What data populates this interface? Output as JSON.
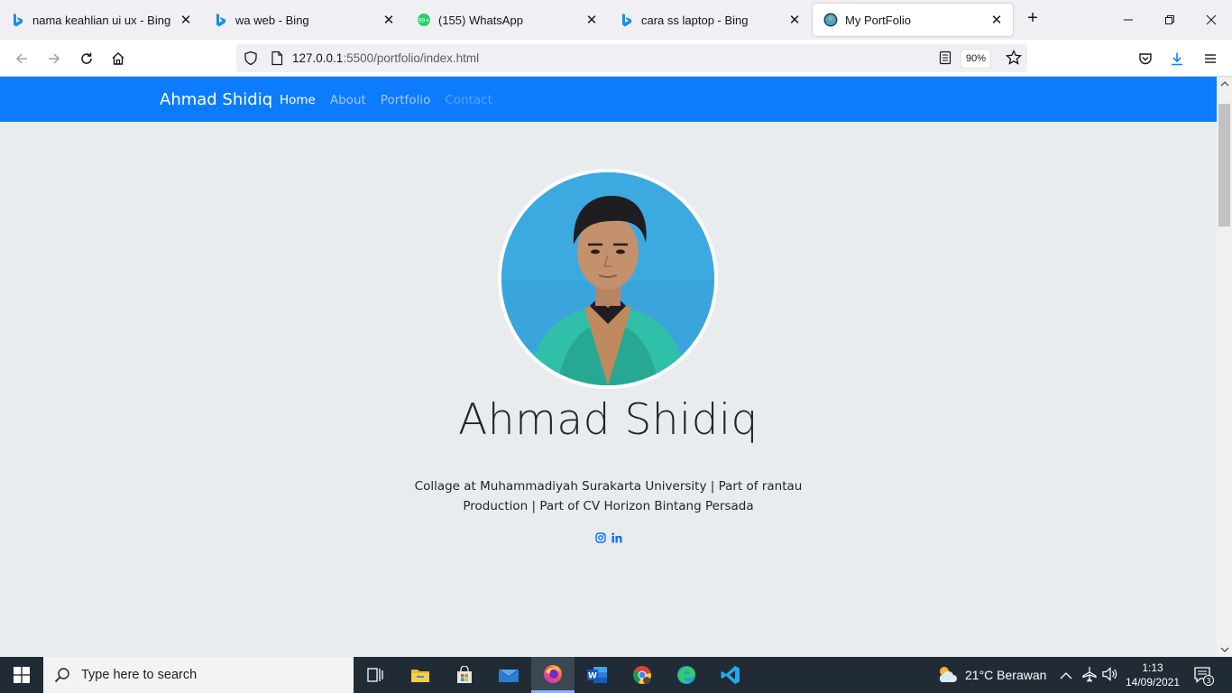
{
  "browser": {
    "tabs": [
      {
        "title": "nama keahlian ui ux - Bing",
        "icon": "bing-icon"
      },
      {
        "title": "wa web - Bing",
        "icon": "bing-icon"
      },
      {
        "title": "(155) WhatsApp",
        "icon": "whatsapp-icon",
        "badge": "99+"
      },
      {
        "title": "cara ss laptop - Bing",
        "icon": "bing-icon"
      },
      {
        "title": "My PortFolio",
        "icon": "portfolio-avatar-icon",
        "active": true
      }
    ],
    "url_host": "127.0.0.1",
    "url_rest": ":5500/portfolio/index.html",
    "zoom": "90%"
  },
  "site": {
    "brand": "Ahmad Shidiq",
    "nav": [
      "Home",
      "About",
      "Portfolio",
      "Contact"
    ],
    "hero_name": "Ahmad Shidiq",
    "hero_desc": "Collage at Muhammadiyah Surakarta University | Part of rantau Production | Part of CV Horizon Bintang Persada",
    "socials": [
      "instagram-icon",
      "linkedin-icon"
    ],
    "colors": {
      "nav_bg": "#0d7bfd",
      "page_bg": "#e9ecef",
      "icon": "#0d6efd"
    }
  },
  "taskbar": {
    "search_placeholder": "Type here to search",
    "weather": "21°C  Berawan",
    "time": "1:13",
    "date": "14/09/2021",
    "notifications": "3"
  }
}
